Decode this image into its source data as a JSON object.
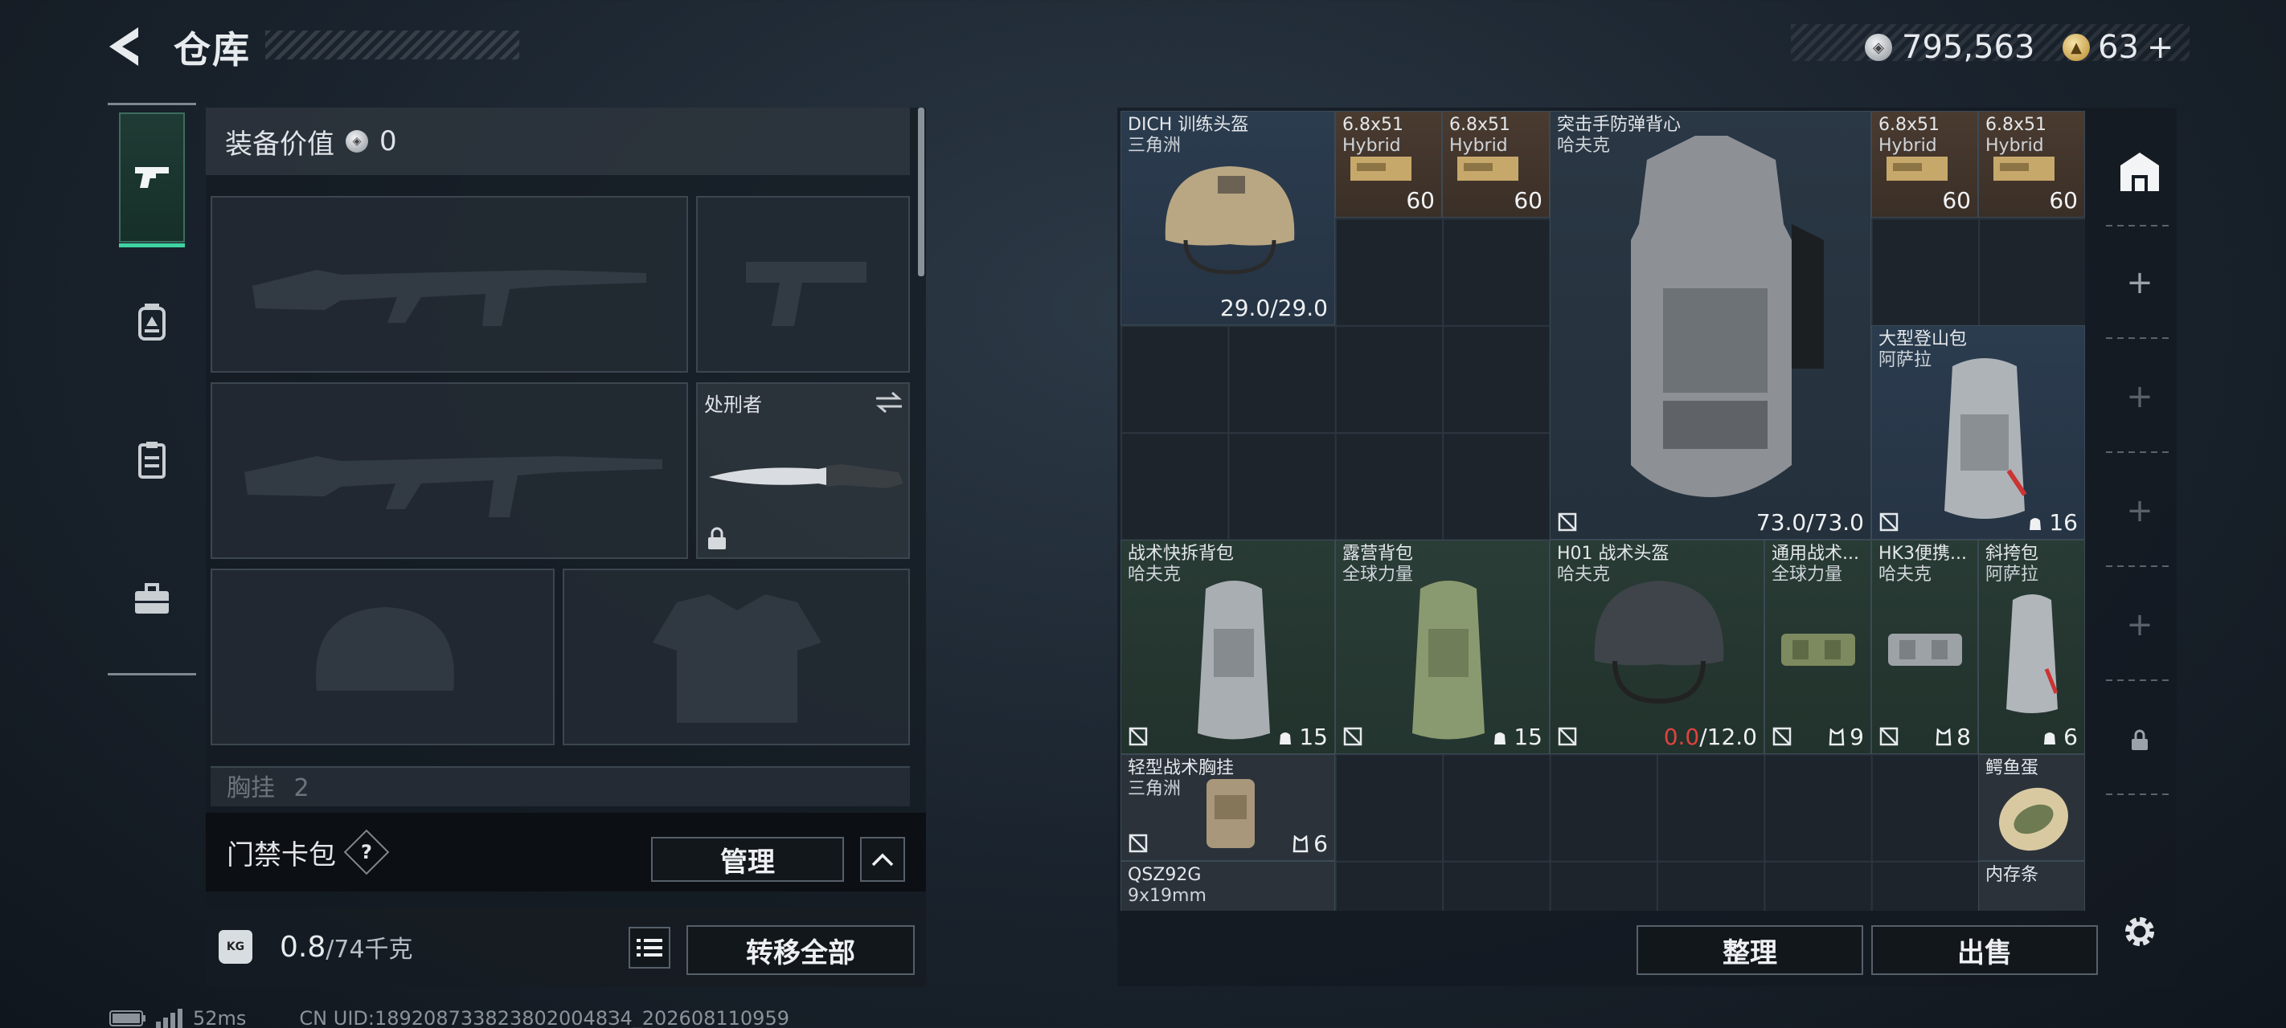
{
  "header": {
    "title": "仓库",
    "back_icon": "back-arrow-icon"
  },
  "currency": {
    "silver_value": "795,563",
    "gold_value": "63",
    "add_symbol": "+"
  },
  "nav": {
    "items": [
      {
        "name": "weapons",
        "icon": "pistol-icon",
        "active": true
      },
      {
        "name": "medical",
        "icon": "medkit-icon"
      },
      {
        "name": "clipboard",
        "icon": "clipboard-icon"
      },
      {
        "name": "toolbox",
        "icon": "toolbox-icon"
      }
    ]
  },
  "equipment": {
    "value_label": "装备价值",
    "value": "0",
    "melee_label": "处刑者",
    "chest_rig_label": "胸挂",
    "chest_rig_count": "2"
  },
  "access_card": {
    "label": "门禁卡包",
    "help": "?",
    "manage_button": "管理"
  },
  "weight": {
    "current": "0.8",
    "max": "/74千克",
    "transfer_all": "转移全部"
  },
  "warehouse": {
    "sort_button": "整理",
    "sell_button": "出售",
    "items": [
      {
        "id": "helmet1",
        "name": "DICH 训练头盔",
        "sub": "三角洲",
        "durability": "29.0/29.0"
      },
      {
        "id": "ammo1",
        "name": "6.8x51",
        "sub": "Hybrid",
        "count": "60"
      },
      {
        "id": "ammo2",
        "name": "6.8x51",
        "sub": "Hybrid",
        "count": "60"
      },
      {
        "id": "vest",
        "name": "突击手防弹背心",
        "sub": "哈夫克",
        "durability": "73.0/73.0"
      },
      {
        "id": "ammo3",
        "name": "6.8x51",
        "sub": "Hybrid",
        "count": "60"
      },
      {
        "id": "ammo4",
        "name": "6.8x51",
        "sub": "Hybrid",
        "count": "60"
      },
      {
        "id": "bigpack",
        "name": "大型登山包",
        "sub": "阿萨拉",
        "capacity": "16"
      },
      {
        "id": "pack1",
        "name": "战术快拆背包",
        "sub": "哈夫克",
        "capacity": "15"
      },
      {
        "id": "pack2",
        "name": "露营背包",
        "sub": "全球力量",
        "capacity": "15"
      },
      {
        "id": "helmet2",
        "name": "H01 战术头盔",
        "sub": "哈夫克",
        "durability_cur": "0.0",
        "durability_max": "/12.0"
      },
      {
        "id": "rig1",
        "name": "通用战术...",
        "sub": "全球力量",
        "capacity": "9"
      },
      {
        "id": "rig2",
        "name": "HK3便携...",
        "sub": "哈夫克",
        "capacity": "8"
      },
      {
        "id": "sling",
        "name": "斜挎包",
        "sub": "阿萨拉",
        "capacity": "6"
      },
      {
        "id": "rig3",
        "name": "轻型战术胸挂",
        "sub": "三角洲",
        "capacity": "6"
      },
      {
        "id": "egg",
        "name": "鳄鱼蛋",
        "sub": ""
      },
      {
        "id": "pistol",
        "name": "QSZ92G",
        "sub": "9x19mm"
      },
      {
        "id": "mem",
        "name": "内存条",
        "sub": ""
      }
    ]
  },
  "status": {
    "ping": "52ms",
    "uid": "CN UID:1892087338238020048З4_202608110959"
  }
}
